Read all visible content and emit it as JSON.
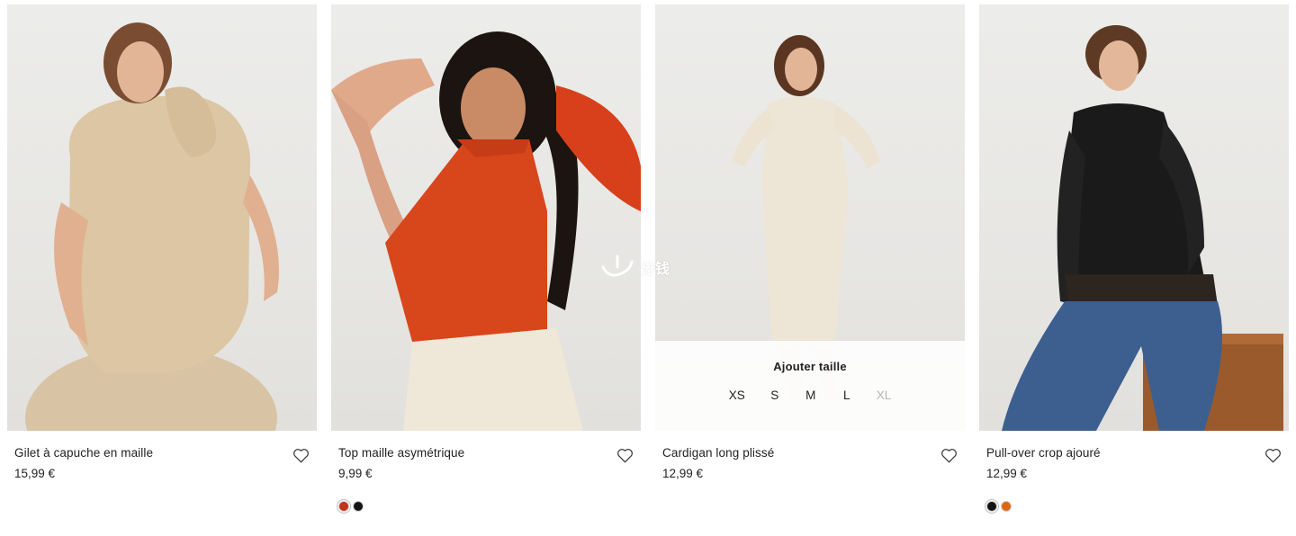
{
  "products": [
    {
      "name": "Gilet à capuche en maille",
      "price": "15,99 €",
      "favorite_icon": "heart-outline-icon",
      "swatches": []
    },
    {
      "name": "Top maille asymétrique",
      "price": "9,99 €",
      "favorite_icon": "heart-outline-icon",
      "swatches": [
        {
          "color": "#c2331a",
          "selected": true
        },
        {
          "color": "#141414",
          "selected": false
        }
      ]
    },
    {
      "name": "Cardigan long plissé",
      "price": "12,99 €",
      "favorite_icon": "heart-outline-icon",
      "swatches": [],
      "size_panel": {
        "title": "Ajouter taille",
        "sizes": [
          {
            "label": "XS",
            "available": true
          },
          {
            "label": "S",
            "available": true
          },
          {
            "label": "M",
            "available": true
          },
          {
            "label": "L",
            "available": true
          },
          {
            "label": "XL",
            "available": false
          }
        ]
      }
    },
    {
      "name": "Pull-over crop ajouré",
      "price": "12,99 €",
      "favorite_icon": "heart-outline-icon",
      "swatches": [
        {
          "color": "#151515",
          "selected": true
        },
        {
          "color": "#e0650f",
          "selected": false
        }
      ]
    }
  ],
  "watermark": {
    "text": "分钱",
    "icon": "watermark-logo-icon"
  }
}
